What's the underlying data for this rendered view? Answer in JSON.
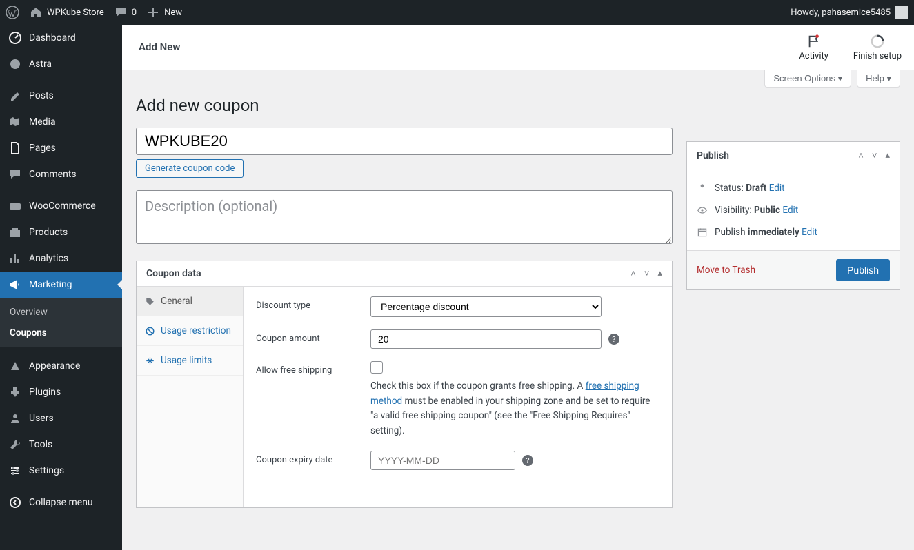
{
  "adminbar": {
    "site_name": "WPKube Store",
    "comments": "0",
    "new": "New",
    "greeting": "Howdy, pahasemice5485"
  },
  "sidebar": {
    "items": [
      "Dashboard",
      "Astra",
      "Posts",
      "Media",
      "Pages",
      "Comments",
      "WooCommerce",
      "Products",
      "Analytics",
      "Marketing",
      "Appearance",
      "Plugins",
      "Users",
      "Tools",
      "Settings",
      "Collapse menu"
    ],
    "submenu": [
      "Overview",
      "Coupons"
    ]
  },
  "header": {
    "title": "Add New",
    "activity": "Activity",
    "finish_setup": "Finish setup"
  },
  "screen_meta": {
    "options": "Screen Options",
    "help": "Help"
  },
  "page": {
    "title": "Add new coupon"
  },
  "form": {
    "coupon_code": "WPKUBE20",
    "generate": "Generate coupon code",
    "description_placeholder": "Description (optional)"
  },
  "coupon_data": {
    "title": "Coupon data",
    "tabs": [
      "General",
      "Usage restriction",
      "Usage limits"
    ],
    "discount_type_label": "Discount type",
    "discount_type_value": "Percentage discount",
    "amount_label": "Coupon amount",
    "amount_value": "20",
    "free_ship_label": "Allow free shipping",
    "free_ship_desc_a": "Check this box if the coupon grants free shipping. A ",
    "free_ship_link": "free shipping method",
    "free_ship_desc_b": " must be enabled in your shipping zone and be set to require \"a valid free shipping coupon\" (see the \"Free Shipping Requires\" setting).",
    "expiry_label": "Coupon expiry date",
    "expiry_placeholder": "YYYY-MM-DD"
  },
  "publish": {
    "title": "Publish",
    "status_label": "Status: ",
    "status_value": "Draft",
    "visibility_label": "Visibility: ",
    "visibility_value": "Public",
    "schedule_label": "Publish ",
    "schedule_value": "immediately",
    "edit": "Edit",
    "trash": "Move to Trash",
    "publish_btn": "Publish"
  }
}
